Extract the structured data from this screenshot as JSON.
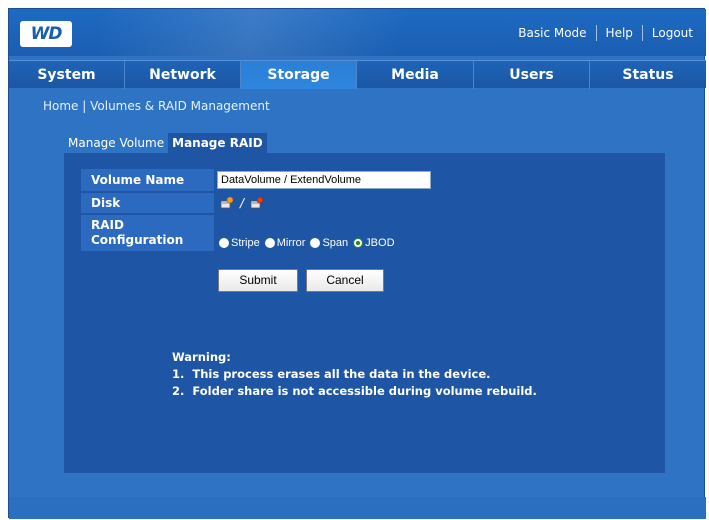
{
  "header": {
    "logo_text": "WD",
    "links": [
      "Basic Mode",
      "Help",
      "Logout"
    ]
  },
  "nav": {
    "tabs": [
      {
        "label": "System",
        "active": false
      },
      {
        "label": "Network",
        "active": false
      },
      {
        "label": "Storage",
        "active": true
      },
      {
        "label": "Media",
        "active": false
      },
      {
        "label": "Users",
        "active": false
      },
      {
        "label": "Status",
        "active": false
      }
    ]
  },
  "breadcrumb": "Home | Volumes & RAID Management",
  "subtabs": [
    {
      "label": "Manage Volume",
      "active": false
    },
    {
      "label": "Manage RAID",
      "active": true
    }
  ],
  "form": {
    "volume_name_label": "Volume Name",
    "volume_name_value": "DataVolume  /  ExtendVolume",
    "disk_label": "Disk",
    "disk_separator": "/",
    "raid_label_line1": "RAID",
    "raid_label_line2": "Configuration",
    "raid_options": [
      {
        "label": "Stripe",
        "selected": false
      },
      {
        "label": "Mirror",
        "selected": false
      },
      {
        "label": "Span",
        "selected": false
      },
      {
        "label": "JBOD",
        "selected": true
      }
    ],
    "submit_label": "Submit",
    "cancel_label": "Cancel"
  },
  "warning": {
    "title": "Warning:",
    "items": [
      "1.  This process erases all the data in the device.",
      "2.  Folder share is not accessible during volume rebuild."
    ]
  },
  "icons": {
    "disk": "disk-icon"
  },
  "colors": {
    "background": "#2f74c4",
    "header": "#1a5eb2",
    "panel": "#1e56a5",
    "row_label": "#2c6ac0",
    "active_tab": "#2f86de"
  }
}
